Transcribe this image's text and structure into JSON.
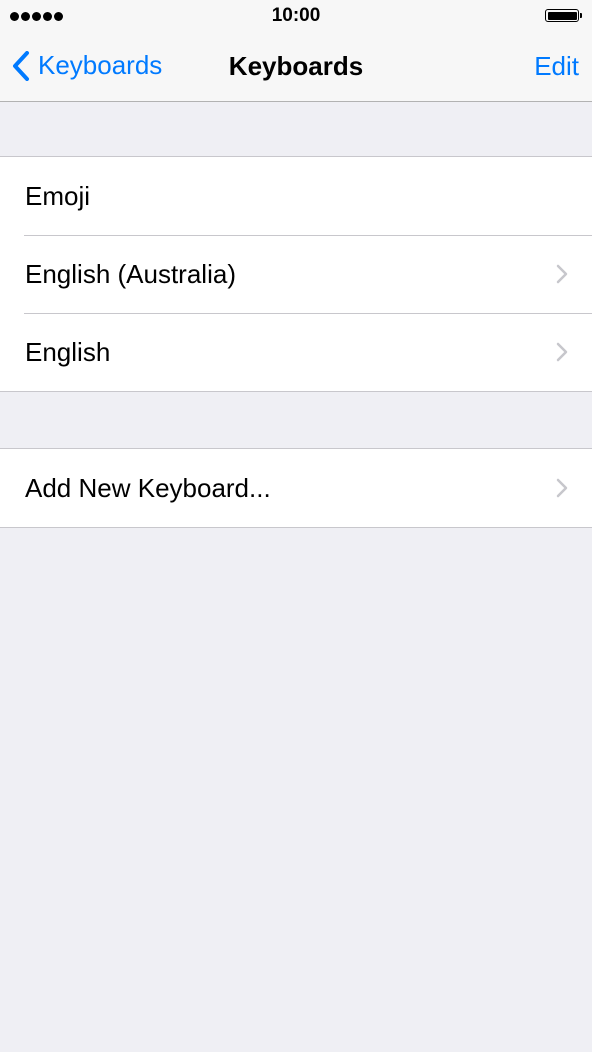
{
  "status_bar": {
    "time": "10:00",
    "signal_dots": 5,
    "battery_icon": "battery-full-icon"
  },
  "nav": {
    "back_label": "Keyboards",
    "title": "Keyboards",
    "edit_label": "Edit",
    "back_icon": "chevron-left-icon"
  },
  "colors": {
    "accent": "#007aff",
    "background": "#efeff4",
    "separator": "#c8c7cc",
    "chevron": "#c7c7cc"
  },
  "keyboards": [
    {
      "label": "Emoji",
      "has_chevron": false
    },
    {
      "label": "English (Australia)",
      "has_chevron": true
    },
    {
      "label": "English",
      "has_chevron": true
    }
  ],
  "add_keyboard": {
    "label": "Add New Keyboard..."
  }
}
